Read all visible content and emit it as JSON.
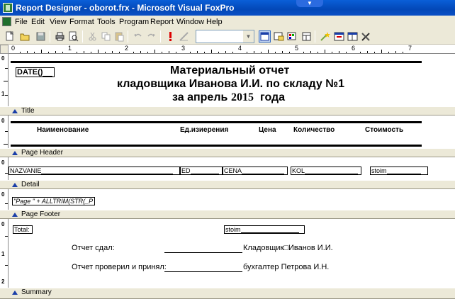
{
  "window": {
    "title": "Report Designer - oborot.frx - Microsoft Visual FoxPro"
  },
  "menu": {
    "items": [
      "File",
      "Edit",
      "View",
      "Format",
      "Tools",
      "Program",
      "Report",
      "Window",
      "Help"
    ]
  },
  "toolbar": {
    "combo_value": ""
  },
  "ruler": {
    "numbers": [
      "0",
      "1",
      "2",
      "3",
      "4",
      "5",
      "6",
      "7"
    ]
  },
  "vruler": {
    "title": [
      "0",
      "1"
    ],
    "page_header": [
      "0"
    ],
    "detail": [
      "0"
    ],
    "page_footer": [
      "0"
    ],
    "summary": [
      "0",
      "1",
      "2"
    ]
  },
  "bands": {
    "title": "Title",
    "page_header": "Page Header",
    "detail": "Detail",
    "page_footer": "Page Footer",
    "summary": "Summary"
  },
  "title_band": {
    "date_field": "DATE()",
    "line1": "Материальный отчет",
    "line2": "кладовщика Иванова И.И. по складу №1",
    "line3_prefix": "за апрель",
    "line3_year": "2015",
    "line3_suffix": "года"
  },
  "page_header": {
    "columns": [
      "Наименование",
      "Ед.изиерения",
      "Цена",
      "Количество",
      "Стоимость"
    ]
  },
  "detail": {
    "fields": [
      "NAZVANIE",
      "ED",
      "CENA",
      "KOL",
      "stoim"
    ]
  },
  "page_footer": {
    "expression": "\"Page \" + ALLTRIM(STR(_P"
  },
  "summary": {
    "total_label": "Total:",
    "total_field": "stoim",
    "row1_label": "Отчет сдал:",
    "row1_value": "Кладовщик□Иванов И.И.",
    "row2_label": "Отчет проверил и принял:",
    "row2_value": "бухгалтер Петрова И.Н."
  }
}
